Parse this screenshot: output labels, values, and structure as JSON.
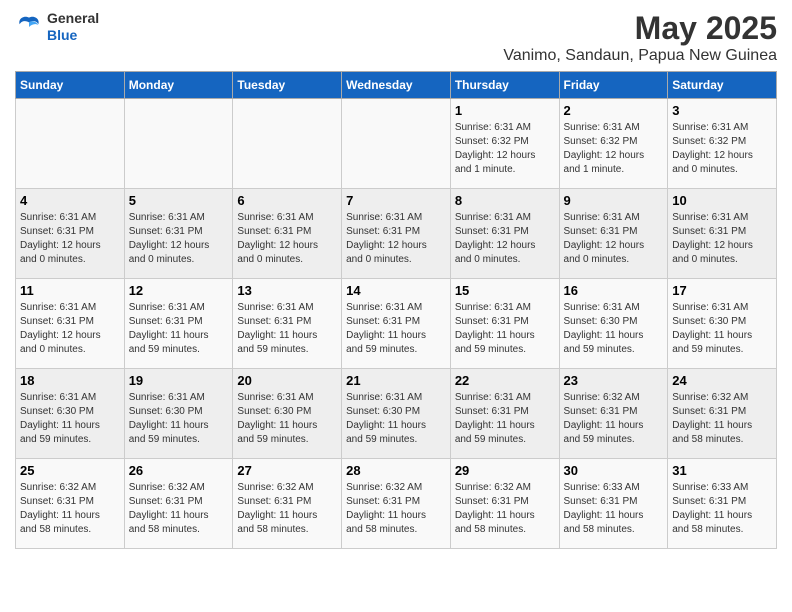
{
  "header": {
    "logo_general": "General",
    "logo_blue": "Blue",
    "month_year": "May 2025",
    "location": "Vanimo, Sandaun, Papua New Guinea"
  },
  "weekdays": [
    "Sunday",
    "Monday",
    "Tuesday",
    "Wednesday",
    "Thursday",
    "Friday",
    "Saturday"
  ],
  "weeks": [
    [
      {
        "day": "",
        "info": ""
      },
      {
        "day": "",
        "info": ""
      },
      {
        "day": "",
        "info": ""
      },
      {
        "day": "",
        "info": ""
      },
      {
        "day": "1",
        "info": "Sunrise: 6:31 AM\nSunset: 6:32 PM\nDaylight: 12 hours\nand 1 minute."
      },
      {
        "day": "2",
        "info": "Sunrise: 6:31 AM\nSunset: 6:32 PM\nDaylight: 12 hours\nand 1 minute."
      },
      {
        "day": "3",
        "info": "Sunrise: 6:31 AM\nSunset: 6:32 PM\nDaylight: 12 hours\nand 0 minutes."
      }
    ],
    [
      {
        "day": "4",
        "info": "Sunrise: 6:31 AM\nSunset: 6:31 PM\nDaylight: 12 hours\nand 0 minutes."
      },
      {
        "day": "5",
        "info": "Sunrise: 6:31 AM\nSunset: 6:31 PM\nDaylight: 12 hours\nand 0 minutes."
      },
      {
        "day": "6",
        "info": "Sunrise: 6:31 AM\nSunset: 6:31 PM\nDaylight: 12 hours\nand 0 minutes."
      },
      {
        "day": "7",
        "info": "Sunrise: 6:31 AM\nSunset: 6:31 PM\nDaylight: 12 hours\nand 0 minutes."
      },
      {
        "day": "8",
        "info": "Sunrise: 6:31 AM\nSunset: 6:31 PM\nDaylight: 12 hours\nand 0 minutes."
      },
      {
        "day": "9",
        "info": "Sunrise: 6:31 AM\nSunset: 6:31 PM\nDaylight: 12 hours\nand 0 minutes."
      },
      {
        "day": "10",
        "info": "Sunrise: 6:31 AM\nSunset: 6:31 PM\nDaylight: 12 hours\nand 0 minutes."
      }
    ],
    [
      {
        "day": "11",
        "info": "Sunrise: 6:31 AM\nSunset: 6:31 PM\nDaylight: 12 hours\nand 0 minutes."
      },
      {
        "day": "12",
        "info": "Sunrise: 6:31 AM\nSunset: 6:31 PM\nDaylight: 11 hours\nand 59 minutes."
      },
      {
        "day": "13",
        "info": "Sunrise: 6:31 AM\nSunset: 6:31 PM\nDaylight: 11 hours\nand 59 minutes."
      },
      {
        "day": "14",
        "info": "Sunrise: 6:31 AM\nSunset: 6:31 PM\nDaylight: 11 hours\nand 59 minutes."
      },
      {
        "day": "15",
        "info": "Sunrise: 6:31 AM\nSunset: 6:31 PM\nDaylight: 11 hours\nand 59 minutes."
      },
      {
        "day": "16",
        "info": "Sunrise: 6:31 AM\nSunset: 6:30 PM\nDaylight: 11 hours\nand 59 minutes."
      },
      {
        "day": "17",
        "info": "Sunrise: 6:31 AM\nSunset: 6:30 PM\nDaylight: 11 hours\nand 59 minutes."
      }
    ],
    [
      {
        "day": "18",
        "info": "Sunrise: 6:31 AM\nSunset: 6:30 PM\nDaylight: 11 hours\nand 59 minutes."
      },
      {
        "day": "19",
        "info": "Sunrise: 6:31 AM\nSunset: 6:30 PM\nDaylight: 11 hours\nand 59 minutes."
      },
      {
        "day": "20",
        "info": "Sunrise: 6:31 AM\nSunset: 6:30 PM\nDaylight: 11 hours\nand 59 minutes."
      },
      {
        "day": "21",
        "info": "Sunrise: 6:31 AM\nSunset: 6:30 PM\nDaylight: 11 hours\nand 59 minutes."
      },
      {
        "day": "22",
        "info": "Sunrise: 6:31 AM\nSunset: 6:31 PM\nDaylight: 11 hours\nand 59 minutes."
      },
      {
        "day": "23",
        "info": "Sunrise: 6:32 AM\nSunset: 6:31 PM\nDaylight: 11 hours\nand 59 minutes."
      },
      {
        "day": "24",
        "info": "Sunrise: 6:32 AM\nSunset: 6:31 PM\nDaylight: 11 hours\nand 58 minutes."
      }
    ],
    [
      {
        "day": "25",
        "info": "Sunrise: 6:32 AM\nSunset: 6:31 PM\nDaylight: 11 hours\nand 58 minutes."
      },
      {
        "day": "26",
        "info": "Sunrise: 6:32 AM\nSunset: 6:31 PM\nDaylight: 11 hours\nand 58 minutes."
      },
      {
        "day": "27",
        "info": "Sunrise: 6:32 AM\nSunset: 6:31 PM\nDaylight: 11 hours\nand 58 minutes."
      },
      {
        "day": "28",
        "info": "Sunrise: 6:32 AM\nSunset: 6:31 PM\nDaylight: 11 hours\nand 58 minutes."
      },
      {
        "day": "29",
        "info": "Sunrise: 6:32 AM\nSunset: 6:31 PM\nDaylight: 11 hours\nand 58 minutes."
      },
      {
        "day": "30",
        "info": "Sunrise: 6:33 AM\nSunset: 6:31 PM\nDaylight: 11 hours\nand 58 minutes."
      },
      {
        "day": "31",
        "info": "Sunrise: 6:33 AM\nSunset: 6:31 PM\nDaylight: 11 hours\nand 58 minutes."
      }
    ]
  ]
}
